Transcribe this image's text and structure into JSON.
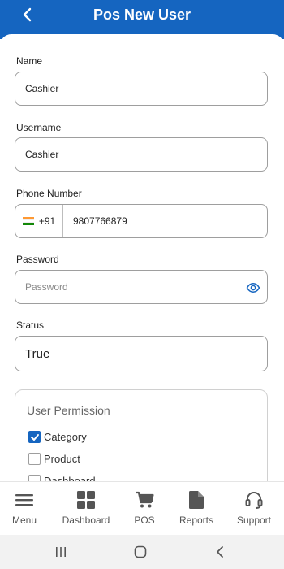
{
  "header": {
    "title": "Pos New User"
  },
  "form": {
    "name": {
      "label": "Name",
      "value": "Cashier"
    },
    "username": {
      "label": "Username",
      "value": "Cashier"
    },
    "phone": {
      "label": "Phone Number",
      "country_code": "+91",
      "value": "9807766879"
    },
    "password": {
      "label": "Password",
      "placeholder": "Password"
    },
    "status": {
      "label": "Status",
      "value": "True"
    }
  },
  "permissions": {
    "title": "User Permission",
    "items": [
      {
        "label": "Category",
        "checked": true
      },
      {
        "label": "Product",
        "checked": false
      },
      {
        "label": "Dashboard",
        "checked": false
      }
    ]
  },
  "bottom_nav": {
    "items": [
      {
        "label": "Menu",
        "icon": "menu-icon"
      },
      {
        "label": "Dashboard",
        "icon": "dashboard-icon"
      },
      {
        "label": "POS",
        "icon": "cart-icon"
      },
      {
        "label": "Reports",
        "icon": "document-icon"
      },
      {
        "label": "Support",
        "icon": "headset-icon"
      }
    ]
  },
  "colors": {
    "primary": "#1565c0",
    "header_text": "#ffffff",
    "border": "#9e9e9e",
    "nav_icon": "#555555"
  }
}
